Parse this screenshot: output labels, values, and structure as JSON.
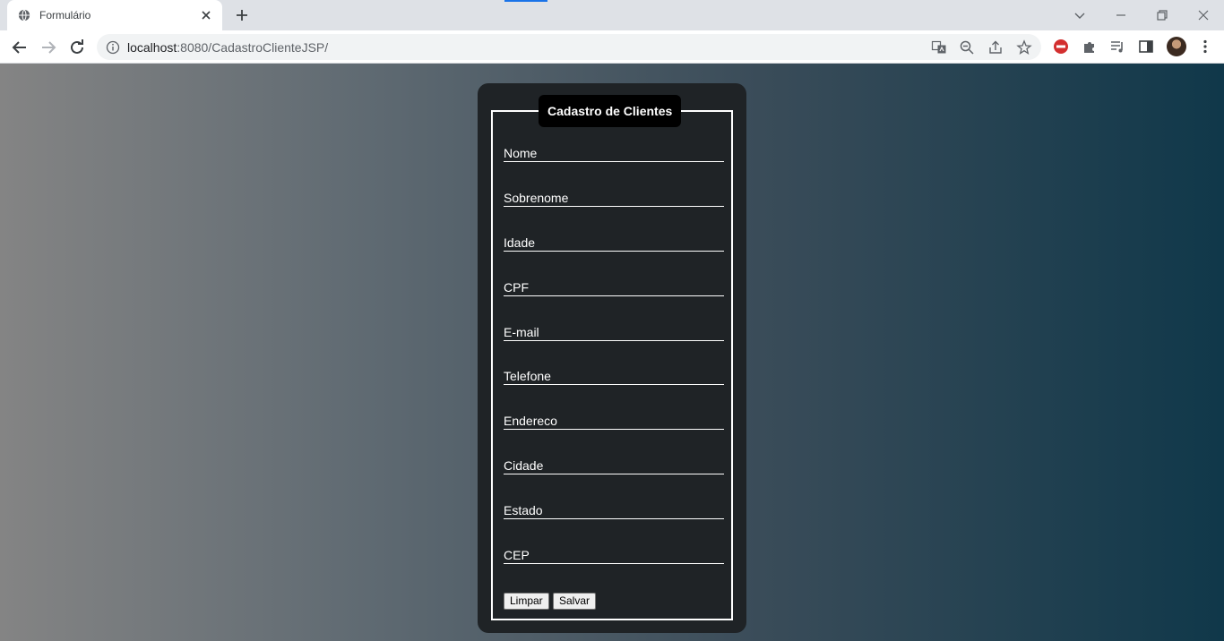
{
  "browser": {
    "tab_title": "Formulário",
    "url_host": "localhost",
    "url_rest": ":8080/CadastroClienteJSP/"
  },
  "form": {
    "legend": "Cadastro de Clientes",
    "fields": [
      {
        "placeholder": "Nome",
        "value": ""
      },
      {
        "placeholder": "Sobrenome",
        "value": ""
      },
      {
        "placeholder": "Idade",
        "value": ""
      },
      {
        "placeholder": "CPF",
        "value": ""
      },
      {
        "placeholder": "E-mail",
        "value": ""
      },
      {
        "placeholder": "Telefone",
        "value": ""
      },
      {
        "placeholder": "Endereco",
        "value": ""
      },
      {
        "placeholder": "Cidade",
        "value": ""
      },
      {
        "placeholder": "Estado",
        "value": ""
      },
      {
        "placeholder": "CEP",
        "value": ""
      }
    ],
    "clear_label": "Limpar",
    "save_label": "Salvar"
  },
  "colors": {
    "card": "#1f2326",
    "legend_bg": "#000000",
    "gradient_start": "#848484",
    "gradient_end": "#10384a"
  }
}
